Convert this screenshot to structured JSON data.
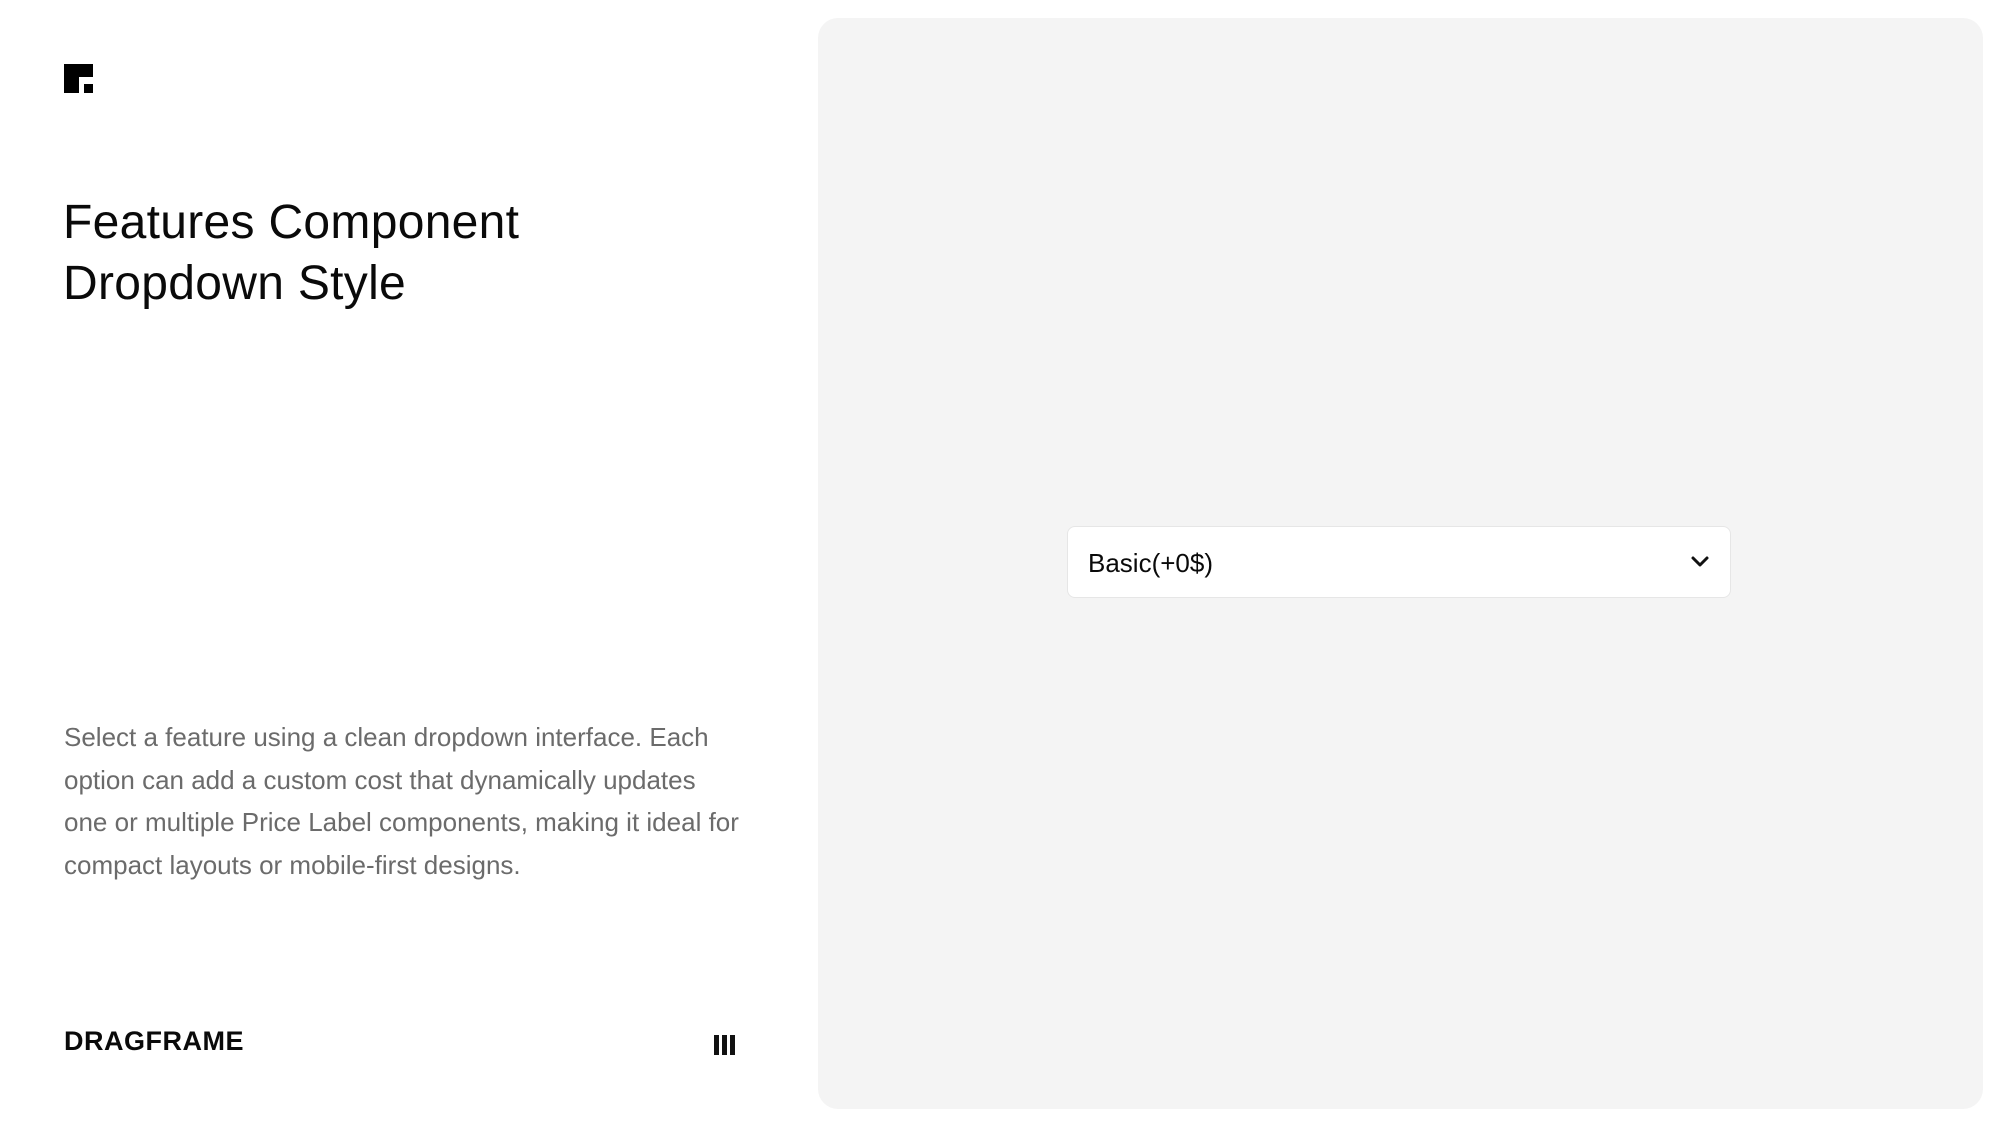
{
  "brand": {
    "name": "DRAGFRAME"
  },
  "header": {
    "title_line1": "Features Component",
    "title_line2": "Dropdown Style"
  },
  "description": "Select a feature using a clean dropdown interface. Each option can add a custom cost that dynamically updates one or multiple Price Label components, making it ideal for compact layouts or mobile-first designs.",
  "preview": {
    "dropdown": {
      "selected_value": "Basic(+0$)"
    }
  },
  "icons": {
    "logo": "framer-logo-icon",
    "menu": "bars-menu-icon",
    "dropdown": "chevron-down-icon"
  },
  "colors": {
    "background": "#ffffff",
    "preview_background": "#f4f4f4",
    "text_primary": "#0a0a0a",
    "text_secondary": "#6b6b6b",
    "dropdown_border": "#e6e6e6"
  }
}
